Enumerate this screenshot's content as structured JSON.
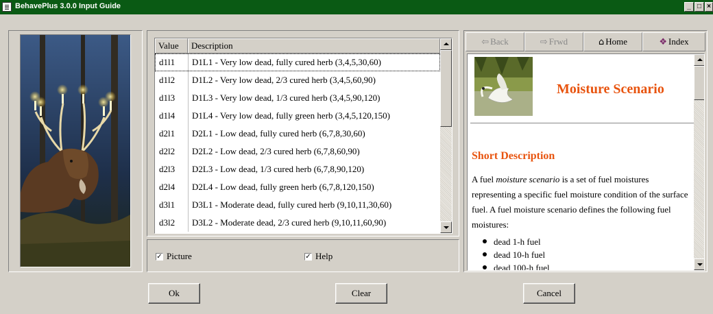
{
  "window": {
    "title": "BehavePlus 3.0.0 Input Guide",
    "controls": [
      "minimize-icon",
      "maximize-icon",
      "close-icon"
    ]
  },
  "list": {
    "columns": [
      "Value",
      "Description"
    ],
    "rows": [
      {
        "value": "d1l1",
        "description": "D1L1 - Very low dead, fully cured herb (3,4,5,30,60)"
      },
      {
        "value": "d1l2",
        "description": "D1L2 - Very low dead, 2/3 cured herb (3,4,5,60,90)"
      },
      {
        "value": "d1l3",
        "description": "D1L3 - Very low dead, 1/3 cured herb (3,4,5,90,120)"
      },
      {
        "value": "d1l4",
        "description": "D1L4 - Very low dead, fully green herb (3,4,5,120,150)"
      },
      {
        "value": "d2l1",
        "description": "D2L1 - Low dead, fully cured herb (6,7,8,30,60)"
      },
      {
        "value": "d2l2",
        "description": "D2L2 - Low dead, 2/3 cured herb (6,7,8,60,90)"
      },
      {
        "value": "d2l3",
        "description": "D2L3 - Low dead, 1/3 cured herb (6,7,8,90,120)"
      },
      {
        "value": "d2l4",
        "description": "D2L4 - Low dead, fully green herb (6,7,8,120,150)"
      },
      {
        "value": "d3l1",
        "description": "D3L1 - Moderate dead, fully cured herb (9,10,11,30,60)"
      },
      {
        "value": "d3l2",
        "description": "D3L2 - Moderate dead, 2/3 cured herb (9,10,11,60,90)"
      }
    ],
    "selected_row": 0
  },
  "options": {
    "picture": {
      "label": "Picture",
      "checked": true
    },
    "help": {
      "label": "Help",
      "checked": true
    }
  },
  "help_toolbar": {
    "back": {
      "label": "Back",
      "icon": "arrow-left-icon",
      "enabled": false
    },
    "forward": {
      "label": "Frwd",
      "icon": "arrow-right-icon",
      "enabled": false
    },
    "home": {
      "label": "Home",
      "icon": "home-icon",
      "enabled": true
    },
    "index": {
      "label": "Index",
      "icon": "book-icon",
      "enabled": true
    }
  },
  "help": {
    "title": "Moisture Scenario",
    "subtitle": "Short Description",
    "para_pre": "A fuel ",
    "para_em": "moisture scenario",
    "para_post": " is a set of fuel moistures representing a specific fuel moisture condition of the surface fuel. A fuel moisture scenario defines the following fuel moistures:",
    "bullets": [
      "dead 1-h fuel",
      "dead 10-h fuel",
      "dead 100-h fuel"
    ]
  },
  "buttons": {
    "ok": "Ok",
    "clear": "Clear",
    "cancel": "Cancel"
  },
  "colors": {
    "titlebar": "#0a5a14",
    "accent": "#e8540f",
    "face": "#d4d0c8"
  }
}
